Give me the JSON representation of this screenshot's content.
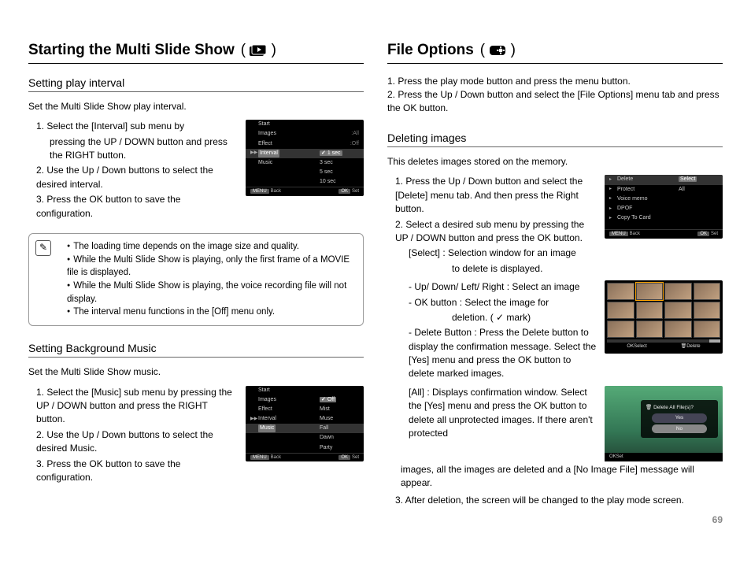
{
  "page_number": "69",
  "left": {
    "title": "Starting the Multi Slide Show",
    "sec1": {
      "heading": "Setting play interval",
      "intro": "Set the Multi Slide Show play interval.",
      "s1": " 1. Select the [Interval] sub menu by",
      "s1b": "pressing the UP / DOWN button and press the RIGHT button.",
      "s2": " 2. Use the Up / Down buttons to select the desired interval.",
      "s3": " 3. Press the OK button to save the configuration."
    },
    "notes": {
      "n1": "The loading time depends on the image size and quality.",
      "n2": "While the Multi Slide Show is playing, only the first frame of a MOVIE file is displayed.",
      "n3": "While the Multi Slide Show is playing, the voice recording file will not display.",
      "n4": "The interval menu functions in the [Off] menu only."
    },
    "sec2": {
      "heading": "Setting Background Music",
      "intro": "Set the Multi Slide Show music.",
      "s1": " 1. Select the [Music] sub menu by pressing the UP / DOWN button and press the RIGHT button.",
      "s2": " 2. Use the Up / Down buttons to select the desired Music.",
      "s3": " 3. Press the OK button to save the configuration."
    },
    "screen1": {
      "items": [
        "Start",
        "Images",
        "Effect",
        "Interval",
        "Music"
      ],
      "rcol": [
        "",
        "",
        "",
        "",
        "",
        "1 sec",
        "3 sec",
        "5 sec",
        "10 sec"
      ],
      "side": [
        ":All",
        ":Off"
      ],
      "foot_l": "Back",
      "foot_r": "Set"
    },
    "screen2": {
      "items": [
        "Start",
        "Images",
        "Effect",
        "Interval",
        "Music"
      ],
      "rcol": [
        "Off",
        "Mist",
        "Muse",
        "Fall",
        "Dawn",
        "Party"
      ],
      "foot_l": "Back",
      "foot_r": "Set"
    }
  },
  "right": {
    "title": "File Options",
    "intro1": "1. Press the play mode button and press the menu button.",
    "intro2": "2. Press the Up / Down button and select the [File Options] menu tab and press the OK button.",
    "sec1": {
      "heading": "Deleting images",
      "intro": "This deletes images stored on the memory.",
      "s1": " 1. Press the Up / Down button and select the [Delete] menu tab. And then press the Right button.",
      "s2": " 2. Select a desired sub menu by pressing the UP / DOWN button and press the OK button.",
      "s2a": "[Select] : Selection window for an image",
      "s2a2": "to delete is displayed.",
      "s2b": "- Up/ Down/ Left/ Right : Select an image",
      "s2c": "- OK button : Select the image for",
      "s2c2": "deletion. ( ✓ mark)",
      "s2d": "- Delete Button : Press the Delete button to display the confirmation message. Select the [Yes] menu and press the OK button to delete marked images.",
      "s2e": "[All] : Displays confirmation window. Select the [Yes] menu and press the OK button to delete all unprotected images. If there aren't protected",
      "s2e2": "images, all the images are deleted and a [No Image File] message will appear.",
      "s3": " 3. After deletion, the screen will be changed to the play mode screen."
    },
    "screenA": {
      "items": [
        "Delete",
        "Protect",
        "Voice memo",
        "DPOF",
        "Copy To Card"
      ],
      "rcol": [
        "Select",
        "All"
      ],
      "foot_l": "Back",
      "foot_r": "Set"
    },
    "screenB": {
      "foot_l": "Select",
      "foot_r": "Delete"
    },
    "screenC": {
      "q": "Delete All File(s)?",
      "yes": "Yes",
      "no": "No",
      "set": "Set"
    }
  }
}
